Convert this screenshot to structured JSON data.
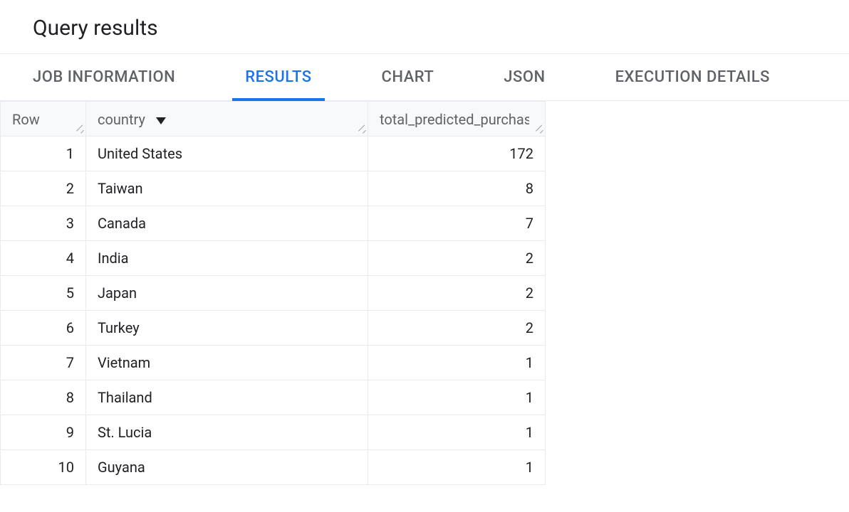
{
  "header": {
    "title": "Query results"
  },
  "tabs": {
    "items": [
      {
        "label": "JOB INFORMATION",
        "active": false
      },
      {
        "label": "RESULTS",
        "active": true
      },
      {
        "label": "CHART",
        "active": false
      },
      {
        "label": "JSON",
        "active": false
      },
      {
        "label": "EXECUTION DETAILS",
        "active": false
      }
    ]
  },
  "table": {
    "columns": {
      "row": {
        "label": "Row"
      },
      "country": {
        "label": "country",
        "sorted": "desc"
      },
      "predicted": {
        "label": "total_predicted_purchases"
      }
    },
    "rows": [
      {
        "n": "1",
        "country": "United States",
        "predicted": "172"
      },
      {
        "n": "2",
        "country": "Taiwan",
        "predicted": "8"
      },
      {
        "n": "3",
        "country": "Canada",
        "predicted": "7"
      },
      {
        "n": "4",
        "country": "India",
        "predicted": "2"
      },
      {
        "n": "5",
        "country": "Japan",
        "predicted": "2"
      },
      {
        "n": "6",
        "country": "Turkey",
        "predicted": "2"
      },
      {
        "n": "7",
        "country": "Vietnam",
        "predicted": "1"
      },
      {
        "n": "8",
        "country": "Thailand",
        "predicted": "1"
      },
      {
        "n": "9",
        "country": "St. Lucia",
        "predicted": "1"
      },
      {
        "n": "10",
        "country": "Guyana",
        "predicted": "1"
      }
    ]
  }
}
